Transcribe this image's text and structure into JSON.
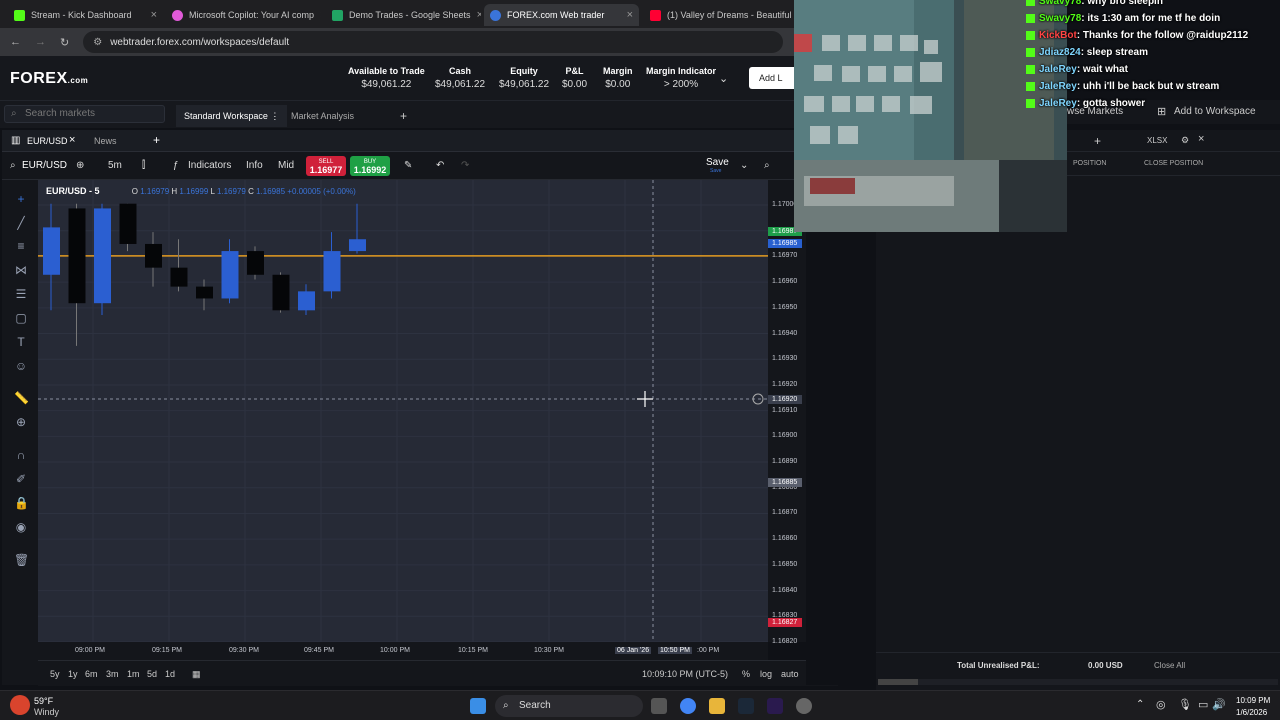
{
  "browser": {
    "tabs": [
      {
        "title": "Stream - Kick Dashboard",
        "color": "#53fc18"
      },
      {
        "title": "Microsoft Copilot: Your AI comp",
        "color": "#e05ad8"
      },
      {
        "title": "Demo Trades - Google Sheets",
        "color": "#21a464"
      },
      {
        "title": "FOREX.com Web trader",
        "color": "#3a74d9"
      },
      {
        "title": "(1) Valley of Dreams - Beautiful",
        "color": "#ff0033"
      }
    ],
    "url": "webtrader.forex.com/workspaces/default"
  },
  "app": {
    "logo_main": "FOREX",
    "logo_suffix": ".com",
    "account": [
      {
        "label": "Available to Trade",
        "value": "$49,061.22"
      },
      {
        "label": "Cash",
        "value": "$49,061.22"
      },
      {
        "label": "Equity",
        "value": "$49,061.22"
      },
      {
        "label": "P&L",
        "value": "$0.00"
      },
      {
        "label": "Margin",
        "value": "$0.00"
      },
      {
        "label": "Margin Indicator",
        "value": "> 200%"
      }
    ],
    "add_button_partial": "Add L",
    "search_placeholder": "Search markets",
    "workspace_tabs": [
      "Standard Workspace",
      "Market Analysis"
    ]
  },
  "chart_panel": {
    "tabs": [
      "EUR/USD",
      "News"
    ],
    "symbol": "EUR/USD",
    "interval": "5m",
    "indicators_label": "Indicators",
    "info_label": "Info",
    "mid_label": "Mid",
    "sell": {
      "label": "SELL",
      "price": "1.16977"
    },
    "buy": {
      "label": "BUY",
      "price": "1.16992"
    },
    "save_label": "Save",
    "save_sub": "Save",
    "legend_title": "EUR/USD - 5",
    "ohlc": {
      "o": "O",
      "o_val": "1.16979",
      "h": "H",
      "h_val": "1.16999",
      "l": "L",
      "l_val": "1.16979",
      "c": "C",
      "c_val": "1.16985",
      "change": "+0.00005 (+0.00%)"
    },
    "ranges": [
      "5y",
      "1y",
      "6m",
      "3m",
      "1m",
      "5d",
      "1d"
    ],
    "clock": "10:09:10 PM (UTC-5)",
    "axis_opts": [
      "%",
      "log",
      "auto"
    ]
  },
  "chart_data": {
    "type": "candlestick",
    "price_labels": [
      "1.17000",
      "1.16980",
      "1.16970",
      "1.16960",
      "1.16950",
      "1.16940",
      "1.16930",
      "1.16920",
      "1.16910",
      "1.16900",
      "1.16890",
      "1.16880",
      "1.16870",
      "1.16860",
      "1.16850",
      "1.16840",
      "1.16830",
      "1.16820"
    ],
    "price_tags": [
      {
        "value": "1.16987",
        "color": "#1e9e4a"
      },
      {
        "value": "1.16985",
        "color": "#2860d0"
      },
      {
        "value": "1.16920",
        "color": "#3a3f4d"
      },
      {
        "value": "1.16885",
        "color": "#5a5f6d"
      },
      {
        "value": "1.16827",
        "color": "#d0213a"
      }
    ],
    "time_labels": [
      "09:00 PM",
      "09:15 PM",
      "09:30 PM",
      "09:45 PM",
      "10:00 PM",
      "10:15 PM",
      "10:30 PM",
      "06 Jan '26",
      "10:50 PM",
      ":00 PM"
    ],
    "ylim": [
      1.16815,
      1.1701
    ],
    "hline": 1.16978,
    "candles": [
      {
        "o": 1.1699,
        "h": 1.17,
        "l": 1.16955,
        "c": 1.1697,
        "dir": "up"
      },
      {
        "o": 1.16998,
        "h": 1.17,
        "l": 1.1694,
        "c": 1.16958,
        "dir": "down"
      },
      {
        "o": 1.16958,
        "h": 1.17,
        "l": 1.16953,
        "c": 1.16998,
        "dir": "up"
      },
      {
        "o": 1.17,
        "h": 1.17,
        "l": 1.1698,
        "c": 1.16983,
        "dir": "down"
      },
      {
        "o": 1.16983,
        "h": 1.16988,
        "l": 1.16965,
        "c": 1.16973,
        "dir": "down"
      },
      {
        "o": 1.16973,
        "h": 1.16985,
        "l": 1.16963,
        "c": 1.16965,
        "dir": "down"
      },
      {
        "o": 1.16965,
        "h": 1.16968,
        "l": 1.16955,
        "c": 1.1696,
        "dir": "down"
      },
      {
        "o": 1.1696,
        "h": 1.16985,
        "l": 1.16958,
        "c": 1.1698,
        "dir": "up"
      },
      {
        "o": 1.1698,
        "h": 1.16982,
        "l": 1.16968,
        "c": 1.1697,
        "dir": "down"
      },
      {
        "o": 1.1697,
        "h": 1.16971,
        "l": 1.16954,
        "c": 1.16955,
        "dir": "down"
      },
      {
        "o": 1.16955,
        "h": 1.16966,
        "l": 1.16953,
        "c": 1.16963,
        "dir": "up"
      },
      {
        "o": 1.16963,
        "h": 1.16988,
        "l": 1.1696,
        "c": 1.1698,
        "dir": "up"
      },
      {
        "o": 1.1698,
        "h": 1.17,
        "l": 1.16979,
        "c": 1.16985,
        "dir": "up"
      }
    ]
  },
  "right_panel": {
    "browse_partial": "wse Markets",
    "add_workspace": "Add to Workspace",
    "xlsx": "XLSX",
    "columns": [
      "POSITION",
      "CLOSE POSITION"
    ],
    "total_label": "Total Unrealised P&L:",
    "total_value": "0.00 USD",
    "close_all": "Close All"
  },
  "stream_chat": [
    {
      "user": "Swavy78",
      "msg": ": why bro sleepin"
    },
    {
      "user": "Swavy78",
      "msg": ": its 1:30 am for me tf he doin"
    },
    {
      "user": "KickBot",
      "msg": ": Thanks for the follow @raidup2112"
    },
    {
      "user": "Jdiaz824",
      "msg": ": sleep stream"
    },
    {
      "user": "JaleRey",
      "msg": ": wait what"
    },
    {
      "user": "JaleRey",
      "msg": ": uhh i'll be back but w stream"
    },
    {
      "user": "JaleRey",
      "msg": ": gotta shower"
    }
  ],
  "taskbar": {
    "weather_temp": "59°F",
    "weather_desc": "Windy",
    "search_label": "Search",
    "time": "10:09 PM",
    "date": "1/6/2026"
  }
}
